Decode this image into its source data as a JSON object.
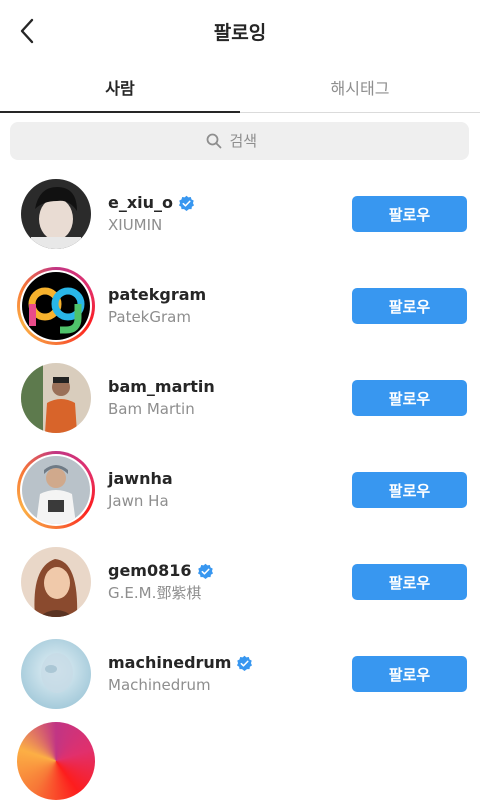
{
  "header": {
    "title": "팔로잉",
    "back_icon": "chevron-left-icon"
  },
  "tabs": [
    {
      "label": "사람",
      "active": true
    },
    {
      "label": "해시태그",
      "active": false
    }
  ],
  "search": {
    "placeholder": "검색",
    "icon": "search-icon"
  },
  "accent_color": "#3897f0",
  "users": [
    {
      "username": "e_xiu_o",
      "fullname": "XIUMIN",
      "verified": true,
      "story_ring": false,
      "follow_label": "팔로우"
    },
    {
      "username": "patekgram",
      "fullname": "PatekGram",
      "verified": false,
      "story_ring": true,
      "follow_label": "팔로우"
    },
    {
      "username": "bam_martin",
      "fullname": "Bam Martin",
      "verified": false,
      "story_ring": false,
      "follow_label": "팔로우"
    },
    {
      "username": "jawnha",
      "fullname": "Jawn Ha",
      "verified": false,
      "story_ring": true,
      "follow_label": "팔로우"
    },
    {
      "username": "gem0816",
      "fullname": "G.E.M.鄧紫棋",
      "verified": true,
      "story_ring": false,
      "follow_label": "팔로우"
    },
    {
      "username": "machinedrum",
      "fullname": "Machinedrum",
      "verified": true,
      "story_ring": false,
      "follow_label": "팔로우"
    }
  ]
}
